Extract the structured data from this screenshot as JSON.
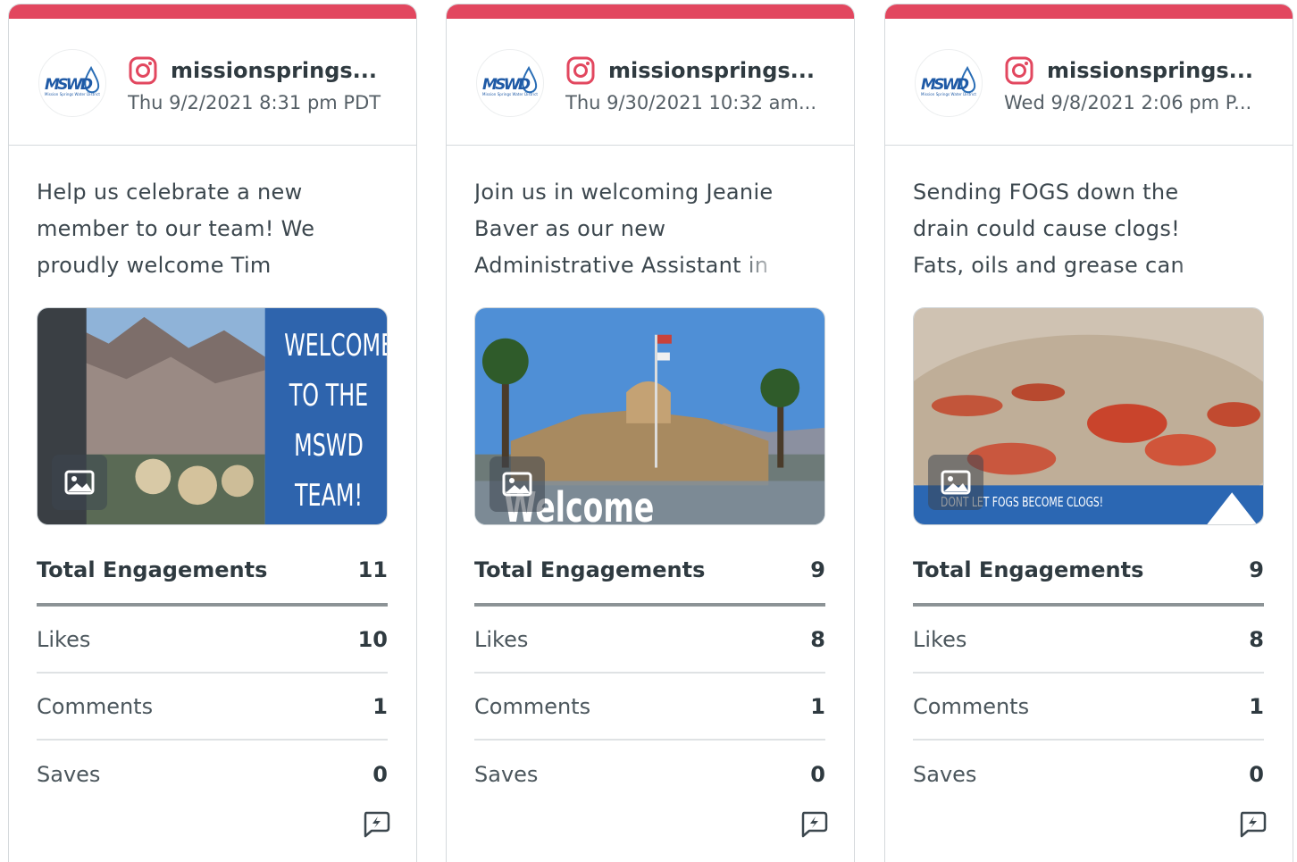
{
  "accent_color": "#e2475f",
  "posts": [
    {
      "handle": "missionsprings...",
      "date": "Thu 9/2/2021 8:31 pm PDT",
      "text": "Help us celebrate a new member to our team! We proudly welcome Tim",
      "media": {
        "type": "image",
        "caption": "WELCOME TO THE MSWD TEAM!"
      },
      "metrics": {
        "total_label": "Total Engagements",
        "total": "11",
        "likes_label": "Likes",
        "likes": "10",
        "comments_label": "Comments",
        "comments": "1",
        "saves_label": "Saves",
        "saves": "0"
      }
    },
    {
      "handle": "missionsprings...",
      "date": "Thu 9/30/2021 10:32 am...",
      "text": "Join us in welcoming Jeanie Baver as our new Administrative Assistant in the",
      "media": {
        "type": "image",
        "caption": "Welcome"
      },
      "metrics": {
        "total_label": "Total Engagements",
        "total": "9",
        "likes_label": "Likes",
        "likes": "8",
        "comments_label": "Comments",
        "comments": "1",
        "saves_label": "Saves",
        "saves": "0"
      }
    },
    {
      "handle": "missionsprings...",
      "date": "Wed 9/8/2021 2:06 pm P...",
      "text": "Sending FOGS down the drain could cause clogs! Fats, oils and grease can easily build up",
      "media": {
        "type": "image",
        "caption": "DONT LET FOGS BECOME CLOGS!"
      },
      "metrics": {
        "total_label": "Total Engagements",
        "total": "9",
        "likes_label": "Likes",
        "likes": "8",
        "comments_label": "Comments",
        "comments": "1",
        "saves_label": "Saves",
        "saves": "0"
      }
    }
  ],
  "avatar_logo_text": "MSWD",
  "avatar_logo_subtext": "Mission Springs Water District",
  "icons": {
    "network": "instagram-icon",
    "media": "image-icon",
    "action": "boost-icon"
  }
}
